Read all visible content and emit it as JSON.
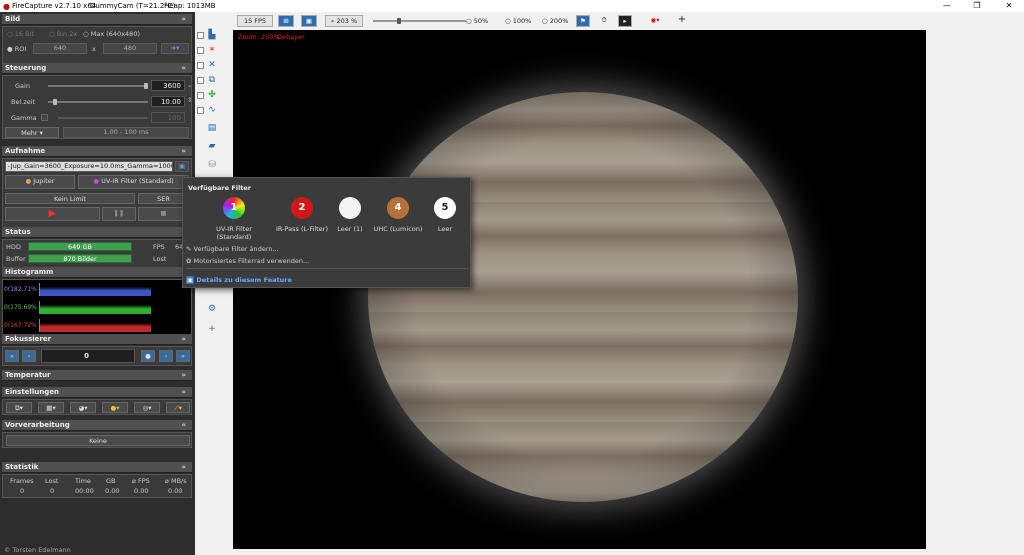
{
  "window": {
    "title": "FireCapture v2.7.10 x64",
    "camera": "DummyCam (T=21.2°C)",
    "heap": "Heap: 1013MB",
    "min": "—",
    "max": "❐",
    "close": "✕"
  },
  "toolbar": {
    "fps": "15 FPS",
    "zoom": "203 %",
    "z50": "50%",
    "z100": "100%",
    "z200": "200%"
  },
  "overlay": {
    "zoom": "Zoom: 203%",
    "debayer": "Debayer"
  },
  "bild": {
    "title": "Bild",
    "bit16": "16 Bit",
    "bin2": "Bin 2x",
    "max": "Max (640x480)",
    "roi": "ROI",
    "w": "640",
    "x": "x",
    "h": "480"
  },
  "steuerung": {
    "title": "Steuerung",
    "gain_label": "Gain",
    "gain_val": "3600",
    "exp_label": "Bel.zeit",
    "exp_val": "10.00",
    "gamma_label": "Gamma",
    "gamma_val": "100",
    "mehr": "Mehr",
    "range": "1.00 - 100 ms"
  },
  "aufnahme": {
    "title": "Aufnahme",
    "file": "-Jup_Gain=3600_Exposure=10.0ms_Gamma=100(off)",
    "object": "Jupiter",
    "filter": "UV-IR Filter (Standard)",
    "limit": "Kein Limit",
    "format": "SER"
  },
  "status": {
    "title": "Status",
    "hdd_label": "HDD",
    "hdd_val": "649 GB",
    "fps_label": "FPS",
    "fps_val": "64",
    "buffer_label": "Buffer",
    "buffer_val": "870 Bilder",
    "lost_label": "Lost"
  },
  "histogramm": {
    "title": "Histogramm",
    "r1": "0(182.71%",
    "r2": "0(175.69%",
    "r3": "0(167.72%"
  },
  "fokus": {
    "title": "Fokussierer",
    "val": "0"
  },
  "temperatur": {
    "title": "Temperatur"
  },
  "einstellungen": {
    "title": "Einstellungen"
  },
  "vorverarbeitung": {
    "title": "Vorverarbeitung",
    "val": "Keine"
  },
  "statistik": {
    "title": "Statistik",
    "headers": [
      "Frames",
      "Lost",
      "Time",
      "GB",
      "⌀ FPS",
      "⌀ MB/s"
    ],
    "values": [
      "0",
      "0",
      "00:00",
      "0.00",
      "0.00",
      "0.00"
    ]
  },
  "copyright": "© Torsten Edelmann",
  "popup": {
    "title": "Verfügbare Filter",
    "filters": [
      {
        "num": "1",
        "label": "UV-IR Filter (Standard)"
      },
      {
        "num": "2",
        "label": "IR-Pass (L-Filter)"
      },
      {
        "num": "",
        "label": "Leer (1)"
      },
      {
        "num": "4",
        "label": "UHC (Lumicon)"
      },
      {
        "num": "5",
        "label": "Leer"
      }
    ],
    "edit": "Verfügbare Filter ändern...",
    "motor": "Motorisiertes Filterrad verwenden...",
    "details": "Details zu diesem Feature"
  }
}
